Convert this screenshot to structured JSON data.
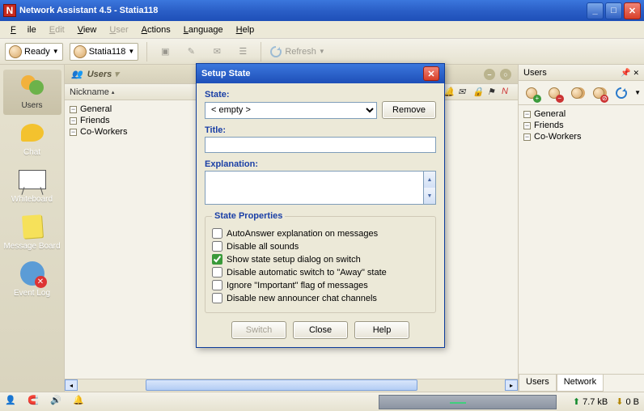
{
  "window": {
    "title": "Network Assistant 4.5 - Statia118"
  },
  "menu": {
    "file": "File",
    "edit": "Edit",
    "view": "View",
    "user": "User",
    "actions": "Actions",
    "language": "Language",
    "help": "Help"
  },
  "toolbar": {
    "ready": "Ready",
    "station": "Statia118",
    "refresh": "Refresh"
  },
  "leftnav": {
    "users": "Users",
    "chat": "Chat",
    "whiteboard": "Whiteboard",
    "msgboard": "Message Board",
    "eventlog": "Event Log"
  },
  "center": {
    "title": "Users",
    "col": "Nickname",
    "groups": [
      "General",
      "Friends",
      "Co-Workers"
    ]
  },
  "rightpanel": {
    "title": "Users",
    "groups": [
      "General",
      "Friends",
      "Co-Workers"
    ],
    "tabs": {
      "users": "Users",
      "network": "Network"
    }
  },
  "status": {
    "up": "7.7 kB",
    "down": "0 B"
  },
  "dialog": {
    "title": "Setup State",
    "state_label": "State:",
    "state_value": "< empty >",
    "remove": "Remove",
    "title_label": "Title:",
    "title_value": "",
    "expl_label": "Explanation:",
    "expl_value": "",
    "props_legend": "State Properties",
    "opts": {
      "autoanswer": "AutoAnswer explanation on messages",
      "disable_sounds": "Disable all sounds",
      "show_setup": "Show state setup dialog on switch",
      "disable_away": "Disable automatic switch to \"Away\" state",
      "ignore_imp": "Ignore \"Important\" flag of messages",
      "disable_ann": "Disable new announcer chat channels"
    },
    "checked": {
      "show_setup": true
    },
    "switch": "Switch",
    "close": "Close",
    "help": "Help"
  }
}
